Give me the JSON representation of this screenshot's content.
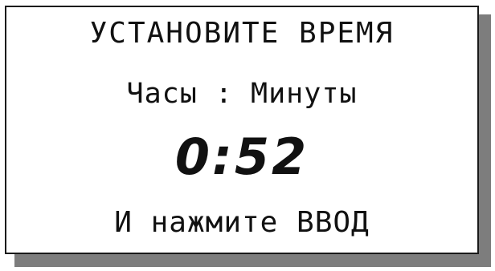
{
  "screen": {
    "title": "УСТАНОВИТЕ ВРЕМЯ",
    "subtitle": "Часы : Минуты",
    "time_value": "0:52",
    "instruction": "И нажмите ВВОД"
  },
  "colors": {
    "text": "#111111",
    "background": "#ffffff",
    "border": "#1a1a1a",
    "shadow": "#7d7d7d"
  }
}
